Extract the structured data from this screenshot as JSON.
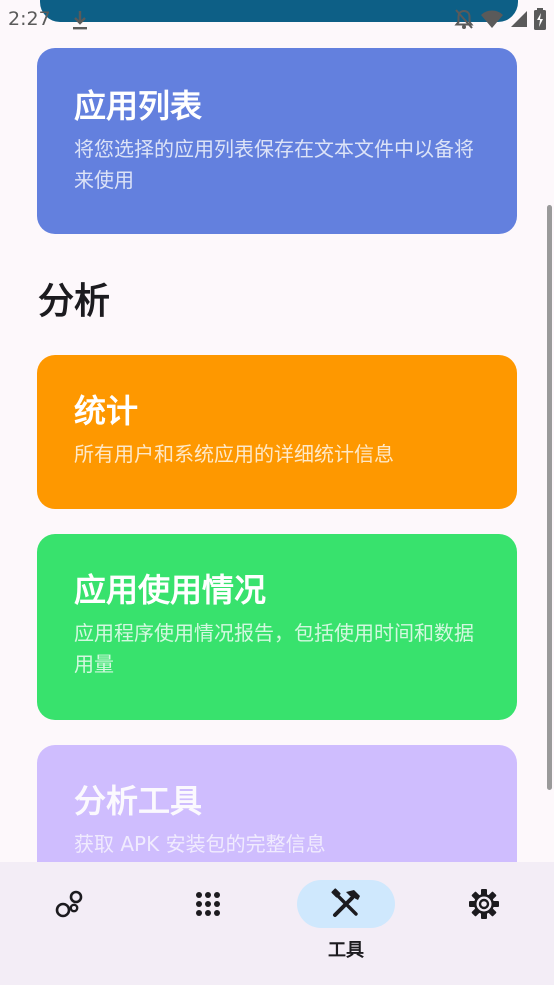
{
  "status_bar": {
    "time": "2:27",
    "icons": [
      "download-icon",
      "notifications-off-icon",
      "wifi-icon",
      "signal-icon",
      "battery-charging-icon"
    ]
  },
  "cards": {
    "app_list": {
      "title": "应用列表",
      "description": "将您选择的应用列表保存在文本文件中以备将来使用",
      "color": "#6380de"
    },
    "statistics": {
      "title": "统计",
      "description": "所有用户和系统应用的详细统计信息",
      "color": "#fe9800"
    },
    "app_usage": {
      "title": "应用使用情况",
      "description": "应用程序使用情况报告，包括使用时间和数据用量",
      "color": "#38e26d"
    },
    "analysis_tools": {
      "title": "分析工具",
      "description": "获取 APK 安装包的完整信息",
      "color": "#cfbdfe"
    }
  },
  "sections": {
    "analysis_heading": "分析"
  },
  "bottom_nav": {
    "items": [
      {
        "icon": "bubbles-icon",
        "label": ""
      },
      {
        "icon": "apps-grid-icon",
        "label": ""
      },
      {
        "icon": "tools-icon",
        "label": "工具",
        "selected": true
      },
      {
        "icon": "settings-gear-icon",
        "label": ""
      }
    ],
    "active_indicator_color": "#cfe8fd"
  }
}
